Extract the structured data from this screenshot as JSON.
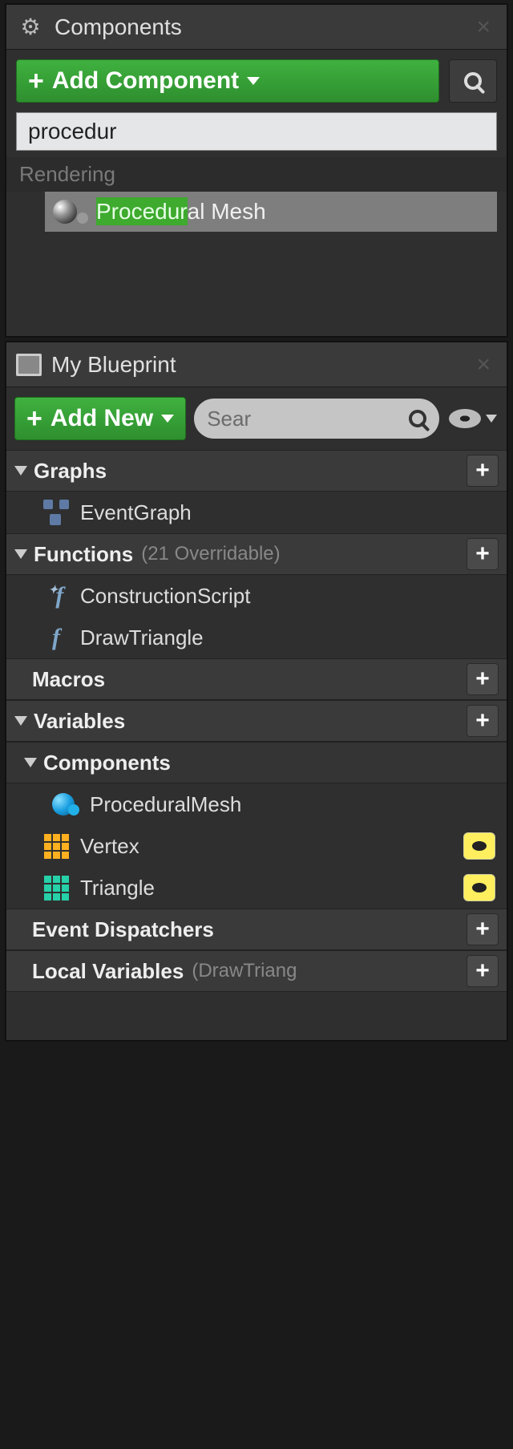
{
  "colors": {
    "accent_green": "#3eaa2e",
    "panel_bg": "#2f2f2f"
  },
  "panel1": {
    "title": "Components",
    "add_label": "Add Component",
    "search_value": "procedur",
    "category": "Rendering",
    "result_highlight": "Procedur",
    "result_rest": "al Mesh"
  },
  "panel2": {
    "title": "My Blueprint",
    "add_label": "Add New",
    "search_placeholder": "Sear",
    "sections": {
      "graphs": {
        "title": "Graphs"
      },
      "functions": {
        "title": "Functions",
        "note": "(21 Overridable)"
      },
      "macros": {
        "title": "Macros"
      },
      "variables": {
        "title": "Variables"
      },
      "components": {
        "title": "Components"
      },
      "dispatchers": {
        "title": "Event Dispatchers"
      },
      "localvars": {
        "title": "Local Variables",
        "note": "(DrawTriang"
      }
    },
    "items": {
      "eventgraph": "EventGraph",
      "construction": "ConstructionScript",
      "drawtriangle": "DrawTriangle",
      "procmesh": "ProceduralMesh",
      "vertex": "Vertex",
      "triangle": "Triangle"
    }
  }
}
